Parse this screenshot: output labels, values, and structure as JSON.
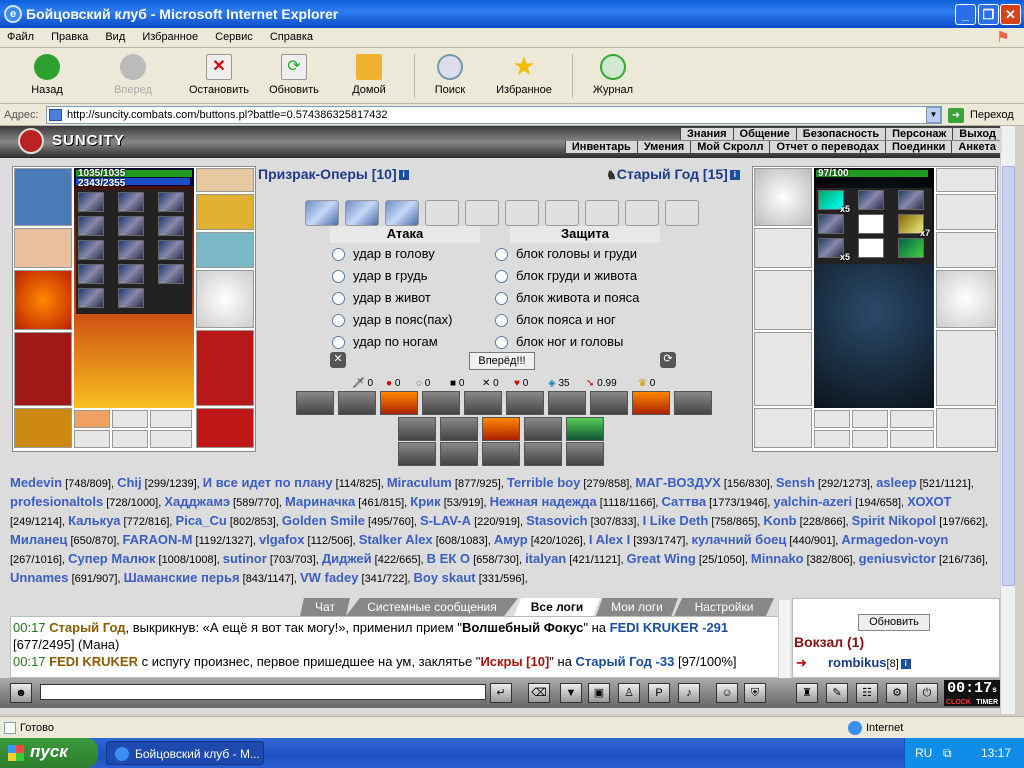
{
  "window": {
    "title": "Бойцовский клуб - Microsoft Internet Explorer"
  },
  "menu": [
    "Файл",
    "Правка",
    "Вид",
    "Избранное",
    "Сервис",
    "Справка"
  ],
  "toolbar": {
    "back": "Назад",
    "forward": "Вперед",
    "stop": "Остановить",
    "refresh": "Обновить",
    "home": "Домой",
    "search": "Поиск",
    "favorites": "Избранное",
    "history": "Журнал"
  },
  "address": {
    "label": "Адрес:",
    "url": "http://suncity.combats.com/buttons.pl?battle=0.574386325817432",
    "go": "Переход"
  },
  "game": {
    "city": "SUNCITY",
    "nav_top": [
      "Знания",
      "Общение",
      "Безопасность",
      "Персонаж",
      "Выход"
    ],
    "nav_bottom": [
      "Инвентарь",
      "Умения",
      "Мой Скролл",
      "Отчет о переводах",
      "Поединки",
      "Анкета"
    ],
    "player": {
      "hp": "1035/1035",
      "mana": "2343/2355",
      "name": "Призрак-Оперы [10]"
    },
    "enemy": {
      "hp": "97/100",
      "name": "Старый Год [15]",
      "stack_labels": [
        "x5",
        "x7",
        "x5"
      ]
    },
    "attack": {
      "title": "Атака",
      "options": [
        "удар в голову",
        "удар в грудь",
        "удар в живот",
        "удар в пояс(пах)",
        "удар по ногам"
      ]
    },
    "defense": {
      "title": "Защита",
      "options": [
        "блок головы и груди",
        "блок груди и живота",
        "блок живота и пояса",
        "блок пояса и ног",
        "блок ног и головы"
      ]
    },
    "fight_button": "Вперёд!!!",
    "stats": [
      "0",
      "0",
      "0",
      "0",
      "0",
      "0",
      "35",
      "0.99",
      "0"
    ]
  },
  "online_players": [
    [
      "Medevin",
      "[748/809],"
    ],
    [
      "Chij",
      "[299/1239],"
    ],
    [
      "И все идет по плану",
      "[114/825],"
    ],
    [
      "Miraculum",
      "[877/925],"
    ],
    [
      "Terrible boy",
      "[279/858],"
    ],
    [
      "МАГ-ВОЗДУХ",
      "[156/830],"
    ],
    [
      "Sensh",
      "[292/1273],"
    ],
    [
      "asleep",
      "[521/1121],"
    ],
    [
      "profesionaltols",
      "[728/1000],"
    ],
    [
      "Хадджамэ",
      "[589/770],"
    ],
    [
      "Мариначка",
      "[461/815],"
    ],
    [
      "Крик",
      "[53/919],"
    ],
    [
      "Нежная надежда",
      "[1118/1166],"
    ],
    [
      "Саттва",
      "[1773/1946],"
    ],
    [
      "yalchin-azeri",
      "[194/658],"
    ],
    [
      "ХОХОТ",
      "[249/1214],"
    ],
    [
      "Калькуа",
      "[772/816],"
    ],
    [
      "Pica_Cu",
      "[802/853],"
    ],
    [
      "Golden Smile",
      "[495/760],"
    ],
    [
      "S-LAV-A",
      "[220/919],"
    ],
    [
      "Stasovich",
      "[307/833],"
    ],
    [
      "I Like Deth",
      "[758/865],"
    ],
    [
      "Konb",
      "[228/866],"
    ],
    [
      "Spirit Nikopol",
      "[197/662],"
    ],
    [
      "Миланец",
      "[650/870],"
    ],
    [
      "FARAON-M",
      "[1192/1327],"
    ],
    [
      "vlgafox",
      "[112/506],"
    ],
    [
      "Stalker Alex",
      "[608/1083],"
    ],
    [
      "Амур",
      "[420/1026],"
    ],
    [
      "I Alex I",
      "[393/1747],"
    ],
    [
      "кулачний боец",
      "[440/901],"
    ],
    [
      "Armagedon-voyn",
      "[267/1016],"
    ],
    [
      "Супер Малюк",
      "[1008/1008],"
    ],
    [
      "sutinor",
      "[703/703],"
    ],
    [
      "Диджей",
      "[422/665],"
    ],
    [
      "В ЕК О",
      "[658/730],"
    ],
    [
      "italyan",
      "[421/1121],"
    ],
    [
      "Great Wing",
      "[25/1050],"
    ],
    [
      "Minnako",
      "[382/806],"
    ],
    [
      "geniusvictor",
      "[216/736],"
    ],
    [
      "Unnames",
      "[691/907],"
    ],
    [
      "Шаманские перья",
      "[843/1147],"
    ],
    [
      "VW fadey",
      "[341/722],"
    ],
    [
      "Boy skaut",
      "[331/596],"
    ]
  ],
  "log_tabs": [
    "Чат",
    "Системные сообщения",
    "Все логи",
    "Мои логи",
    "Настройки"
  ],
  "log": [
    {
      "time": "00:17",
      "actor": "Старый Год",
      "text1": ", выкрикнув: «А ещё я вот так могу!», применил прием \"",
      "skill": "Волшебный Фокус",
      "text2": "\" на ",
      "target": "FEDI KRUKER",
      "dmg": "-291",
      "rest": " [677/2495] (Мана)"
    },
    {
      "time": "00:17",
      "actor": "FEDI KRUKER",
      "text1": " с испугу произнес, первое пришедшее на ум, заклятье \"",
      "skill": "Искры [10]",
      "text2": "\" на ",
      "target": "Старый Год",
      "dmg": "-33",
      "rest": " [97/100%]"
    }
  ],
  "side": {
    "refresh": "Обновить",
    "station": "Вокзал (1)",
    "user": "rombikus",
    "user_level": "[8]"
  },
  "clock": {
    "time": "00:17",
    "sec": "s",
    "label1": "CLOCK",
    "label2": "TIMER"
  },
  "status": {
    "left": "Готово",
    "zone": "Internet"
  },
  "taskbar": {
    "start": "пуск",
    "task": "Бойцовский клуб - М...",
    "lang": "RU",
    "time": "13:17"
  }
}
